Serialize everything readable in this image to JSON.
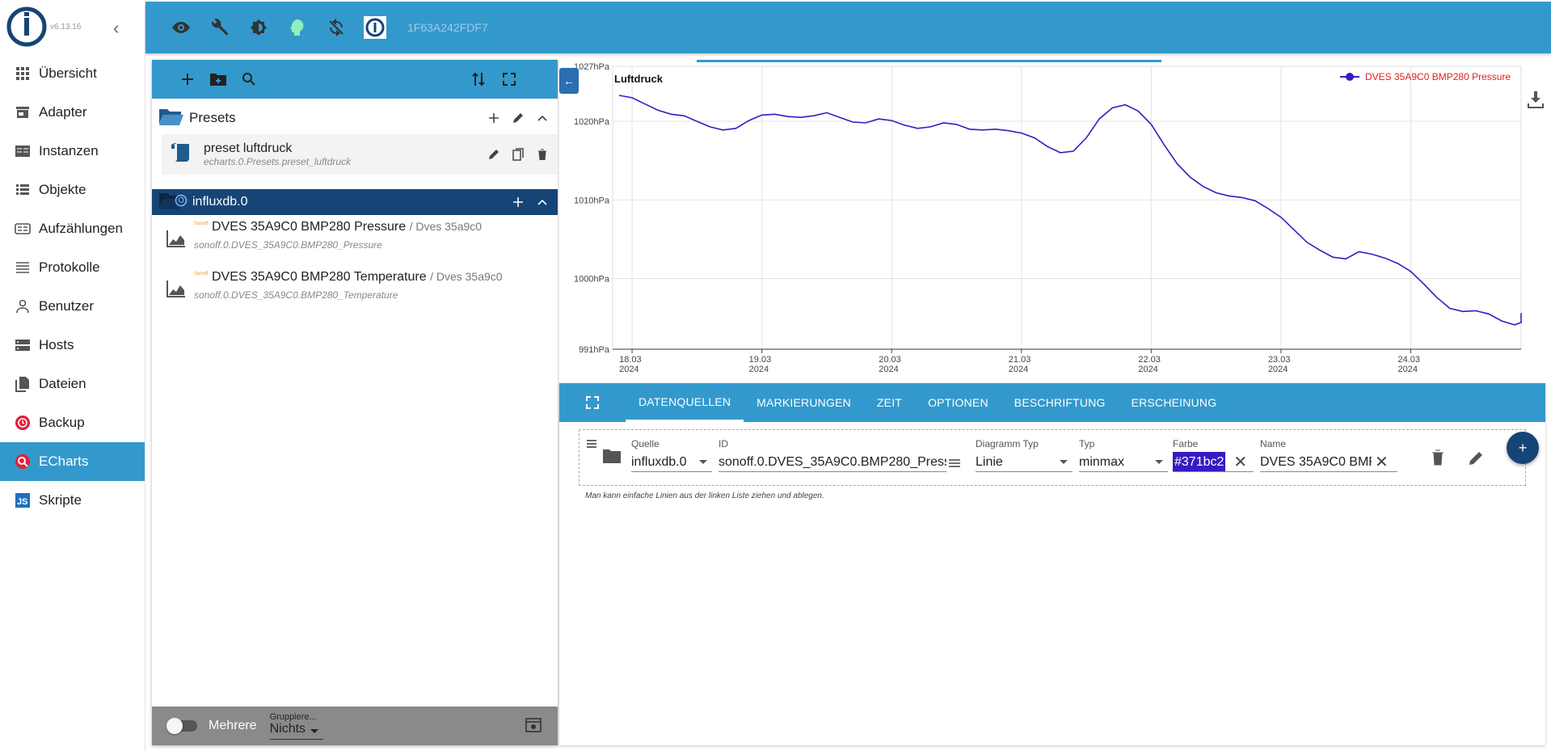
{
  "app": {
    "version": "v6.13.16",
    "host_id": "1F63A242FDF7"
  },
  "sidebar": {
    "items": [
      {
        "label": "Übersicht",
        "icon": "grid-icon"
      },
      {
        "label": "Adapter",
        "icon": "store-icon"
      },
      {
        "label": "Instanzen",
        "icon": "instances-icon"
      },
      {
        "label": "Objekte",
        "icon": "list-icon"
      },
      {
        "label": "Aufzählungen",
        "icon": "enum-icon"
      },
      {
        "label": "Protokolle",
        "icon": "log-icon"
      },
      {
        "label": "Benutzer",
        "icon": "user-icon"
      },
      {
        "label": "Hosts",
        "icon": "hosts-icon"
      },
      {
        "label": "Dateien",
        "icon": "files-icon"
      },
      {
        "label": "Backup",
        "icon": "backup-icon"
      },
      {
        "label": "ECharts",
        "icon": "echarts-icon"
      },
      {
        "label": "Skripte",
        "icon": "js-icon"
      }
    ],
    "active_index": 10
  },
  "left": {
    "presets_folder": "Presets",
    "preset": {
      "title": "preset luftdruck",
      "id": "echarts.0.Presets.preset_luftdruck"
    },
    "db_instance": "influxdb.0",
    "states": [
      {
        "title": "DVES 35A9C0 BMP280 Pressure",
        "room": "/ Dves 35a9c0",
        "id": "sonoff.0.DVES_35A9C0.BMP280_Pressure",
        "tag": "Sonoff"
      },
      {
        "title": "DVES 35A9C0 BMP280 Temperature",
        "room": "/ Dves 35a9c0",
        "id": "sonoff.0.DVES_35A9C0.BMP280_Temperature",
        "tag": "Sonoff"
      }
    ],
    "footer": {
      "toggle_label": "Mehrere",
      "group_label": "Gruppiere...",
      "group_value": "Nichts"
    }
  },
  "chart_data": {
    "type": "line",
    "title": "Luftdruck",
    "legend": "DVES 35A9C0 BMP280  Pressure",
    "legend_position": "top-right",
    "color": "#371bc2",
    "y_axis": {
      "ticks": [
        "991hPa",
        "1000hPa",
        "1010hPa",
        "1020hPa",
        "1027hPa"
      ],
      "min": 991,
      "max": 1027
    },
    "x_axis": {
      "ticks": [
        [
          "18.03",
          "2024"
        ],
        [
          "19.03",
          "2024"
        ],
        [
          "20.03",
          "2024"
        ],
        [
          "21.03",
          "2024"
        ],
        [
          "22.03",
          "2024"
        ],
        [
          "23.03",
          "2024"
        ],
        [
          "24.03",
          "2024"
        ]
      ]
    },
    "grid": true,
    "x": [
      17.9,
      18.0,
      18.1,
      18.2,
      18.3,
      18.4,
      18.5,
      18.6,
      18.7,
      18.8,
      18.9,
      19.0,
      19.1,
      19.2,
      19.3,
      19.4,
      19.5,
      19.6,
      19.7,
      19.8,
      19.9,
      20.0,
      20.1,
      20.2,
      20.3,
      20.4,
      20.5,
      20.6,
      20.7,
      20.8,
      20.9,
      21.0,
      21.1,
      21.2,
      21.3,
      21.4,
      21.5,
      21.6,
      21.7,
      21.8,
      21.9,
      22.0,
      22.1,
      22.2,
      22.3,
      22.4,
      22.5,
      22.6,
      22.7,
      22.8,
      22.9,
      23.0,
      23.1,
      23.2,
      23.3,
      23.4,
      23.5,
      23.6,
      23.7,
      23.8,
      23.9,
      24.0,
      24.1,
      24.2,
      24.3,
      24.4,
      24.5,
      24.6,
      24.7,
      24.8,
      24.9,
      25.0
    ],
    "values": [
      1023.3,
      1023.0,
      1022.2,
      1021.4,
      1020.9,
      1020.7,
      1020.0,
      1019.3,
      1018.9,
      1019.1,
      1020.1,
      1020.8,
      1020.9,
      1020.6,
      1020.5,
      1020.7,
      1021.1,
      1020.5,
      1019.9,
      1019.8,
      1020.3,
      1020.1,
      1019.5,
      1019.1,
      1019.3,
      1019.8,
      1019.6,
      1019.0,
      1018.9,
      1019.0,
      1018.8,
      1018.5,
      1017.9,
      1016.8,
      1016.0,
      1016.2,
      1017.9,
      1020.3,
      1021.7,
      1022.1,
      1021.3,
      1019.6,
      1017.0,
      1014.6,
      1012.9,
      1011.7,
      1010.9,
      1010.5,
      1010.3,
      1009.9,
      1008.9,
      1007.8,
      1006.2,
      1004.6,
      1003.6,
      1002.7,
      1002.5,
      1003.4,
      1003.1,
      1002.6,
      1001.9,
      1000.9,
      999.3,
      997.6,
      996.2,
      995.8,
      995.9,
      995.5,
      994.6,
      994.1,
      994.4,
      995.6
    ]
  },
  "tabs": [
    "DATENQUELLEN",
    "MARKIERUNGEN",
    "ZEIT",
    "OPTIONEN",
    "BESCHRIFTUNG",
    "ERSCHEINUNG"
  ],
  "line": {
    "quelle_label": "Quelle",
    "quelle_value": "influxdb.0",
    "id_label": "ID",
    "id_value": "sonoff.0.DVES_35A9C0.BMP280_Pressure",
    "diagram_label": "Diagramm Typ",
    "diagram_value": "Linie",
    "typ_label": "Typ",
    "typ_value": "minmax",
    "farbe_label": "Farbe",
    "farbe_value": "#371bc2",
    "name_label": "Name",
    "name_value": "DVES 35A9C0 BMP280 Pressure"
  },
  "hint": "Man kann einfache Linien aus der linken Liste ziehen und ablegen."
}
